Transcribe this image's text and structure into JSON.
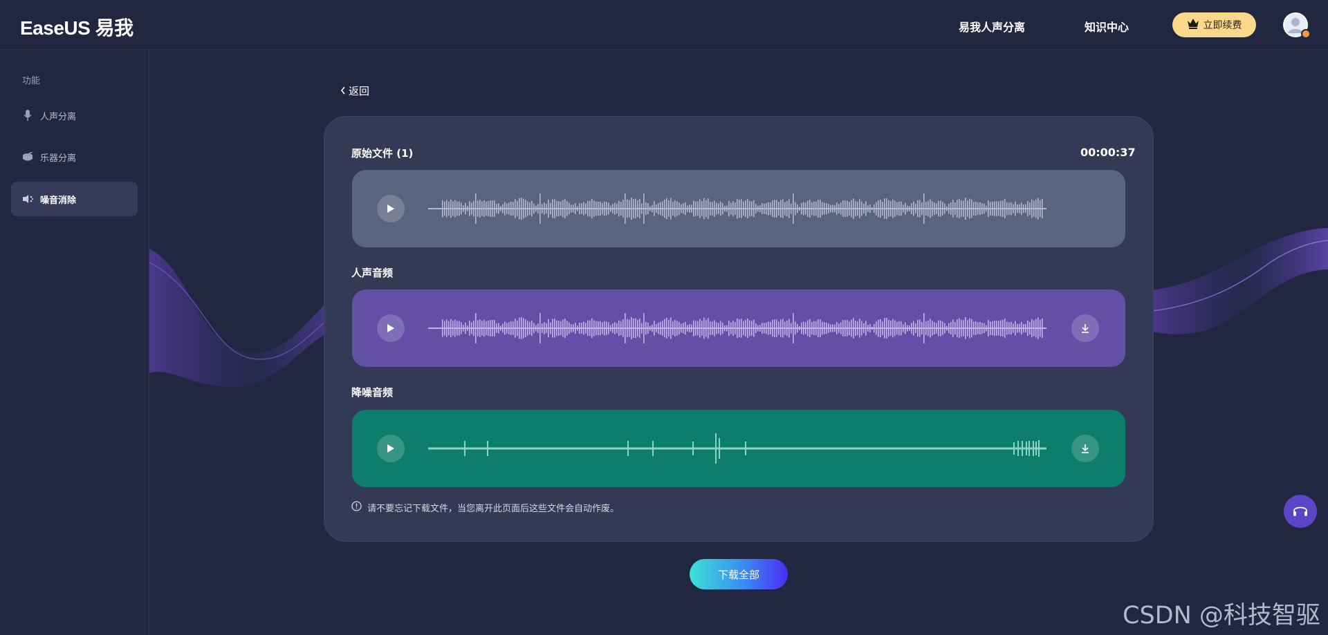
{
  "header": {
    "logo": "EaseUS 易我",
    "nav": [
      "易我人声分离",
      "知识中心"
    ],
    "renew_label": "立即续费"
  },
  "sidebar": {
    "title": "功能",
    "items": [
      {
        "label": "人声分离",
        "icon": "mic-icon",
        "active": false
      },
      {
        "label": "乐器分离",
        "icon": "drum-icon",
        "active": false
      },
      {
        "label": "噪音消除",
        "icon": "noise-icon",
        "active": true
      }
    ]
  },
  "main": {
    "back_label": "返回",
    "original": {
      "label": "原始文件 (1)",
      "duration": "00:00:37"
    },
    "voice": {
      "label": "人声音频"
    },
    "denoise": {
      "label": "降噪音频"
    },
    "notice": "请不要忘记下载文件，当您离开此页面后这些文件会自动作废。",
    "download_all": "下载全部"
  },
  "colors": {
    "background": "#222741",
    "card": "#323a55",
    "original_track": "#5b647f",
    "voice_track": "#6250a7",
    "denoise_track": "#0d7e6c",
    "renew": "#fbd88a"
  },
  "watermark": "CSDN @科技智驱"
}
